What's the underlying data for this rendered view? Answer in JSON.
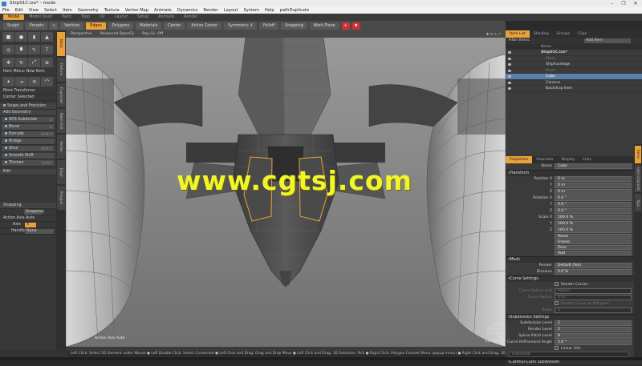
{
  "window": {
    "title": "Ship01C.lxo* - modo",
    "controls": [
      "–",
      "❐",
      "✕"
    ]
  },
  "menu": [
    "File",
    "Edit",
    "View",
    "Select",
    "Item",
    "Geometry",
    "Texture",
    "Vertex Map",
    "Animate",
    "Dynamics",
    "Render",
    "Layout",
    "System",
    "Help",
    "pathDuplicate"
  ],
  "layout_tabs": [
    {
      "label": "Model",
      "active": true
    },
    {
      "label": "Model Quad"
    },
    {
      "label": "Paint"
    },
    {
      "label": "Topo"
    },
    {
      "label": "UV"
    },
    {
      "label": "Layout"
    },
    {
      "label": "Setup"
    },
    {
      "label": "Animate"
    },
    {
      "label": "Render"
    }
  ],
  "toolbar": {
    "sculpt": "Sculpt",
    "presets": "Presets",
    "vertices": "Vertices",
    "edges": "Edges",
    "polygons": "Polygons",
    "materials": "Materials",
    "center": "Center",
    "action_center": "Action Center",
    "symmetry": "Symmetry: X",
    "falloff": "Falloff",
    "snapping": "Snapping",
    "work_plane": "Work Plane"
  },
  "left_panel": {
    "menu": "Item Menu: New Item",
    "more_transforms": "More Transforms",
    "center_selected": "Center Selected",
    "snaps": "Snaps and Precision",
    "add_geometry": "Add Geometry",
    "tools": [
      {
        "label": "SDS Subdivide",
        "shortcut": "D"
      },
      {
        "label": "Bevel",
        "shortcut": "B"
      },
      {
        "label": "Extrude",
        "shortcut": "Shift-X"
      },
      {
        "label": "Bridge",
        "shortcut": ""
      },
      {
        "label": "Slice",
        "shortcut": "Shift-C"
      },
      {
        "label": "Smooth Shift",
        "shortcut": ""
      },
      {
        "label": "Thicken",
        "shortcut": "Shift-T"
      }
    ],
    "edit": "Edit",
    "snapping_header": "Snapping",
    "snapping_value": "Snapping",
    "action_axis": "Action Axis Auto",
    "axis_label": "Axis",
    "axis_value": "X",
    "handle_label": "Handle",
    "handle_value": "None"
  },
  "left_tabs": [
    "Basic",
    "Deform",
    "Duplicate",
    "Mesh Edit",
    "Vertex",
    "Edge",
    "Polygon"
  ],
  "viewport": {
    "view_mode": "Perspective",
    "shading": "Advanced OpenGL",
    "ray_gl": "Ray GL: Off",
    "axis_text": "Action Axis Auto",
    "info": [
      "8 Edges",
      "Channels: 0",
      "Deformers: OFF",
      "GL: 365,068"
    ]
  },
  "watermark": "www.cgtsj.com",
  "status_bar": "Left Click: Select 3D Element under Mouse ● Left Double Click: Select Connected ● Left Click and Drag: Drag and Drop Move ● Left Click and Drag: 3D Selection: Pick ● Right Click: Polygon Context Menu (popup menu) ● Right Click and Drag: 3D Selection: Area ● Mi...",
  "item_list": {
    "tabs": [
      "Item List",
      "Shading",
      "Groups",
      "Clips"
    ],
    "add_item": "Add Item",
    "filter": "Filter Items",
    "name_col": "Name",
    "items": [
      {
        "label": "Ship01C.lxo*",
        "indent": 0
      },
      {
        "label": "Mesh",
        "indent": 1
      },
      {
        "label": "ShipFuselage",
        "indent": 1
      },
      {
        "label": "Mesh",
        "indent": 1
      },
      {
        "label": "Cube",
        "indent": 1,
        "selected": true
      },
      {
        "label": "Camera",
        "indent": 1
      },
      {
        "label": "Backdrop Item",
        "indent": 1
      }
    ]
  },
  "properties": {
    "tabs": [
      "Properties",
      "Channels",
      "Display",
      "Lists"
    ],
    "name_label": "Name",
    "name_value": "Cube",
    "transform_section": "Transform",
    "transform_rows": [
      {
        "label": "Position X",
        "value": "0 m"
      },
      {
        "label": "Y",
        "value": "0 m"
      },
      {
        "label": "Z",
        "value": "0 m"
      },
      {
        "label": "Rotation X",
        "value": "0.0 °"
      },
      {
        "label": "Y",
        "value": "0.0 °"
      },
      {
        "label": "Z",
        "value": "0.0 °"
      },
      {
        "label": "Scale X",
        "value": "100.0 %"
      },
      {
        "label": "Y",
        "value": "100.0 %"
      },
      {
        "label": "Z",
        "value": "100.0 %"
      }
    ],
    "transform_buttons": [
      "Reset",
      "Freeze",
      "Zero",
      "Add"
    ],
    "mesh_section": "Mesh",
    "render_label": "Render",
    "render_value": "Default (Yes)",
    "dissolve_label": "Dissolve",
    "dissolve_value": "0.0 %",
    "curve_section": "Curve Settings",
    "render_curves": "Render Curves",
    "curve_radius_unit": "Curve Radius Unit",
    "curve_radius_unit_value": "Meters",
    "curve_radius": "Curve Radius",
    "curve_radius_value": "0 m",
    "render_curve_poly": "Render Curve as Polygons",
    "sides": "Sides",
    "sides_value": "3",
    "subdiv_section": "Subdivision Settings",
    "subdiv_level": "Subdivision Level",
    "subdiv_level_value": "2",
    "render_level": "Render Level",
    "render_level_value": "2",
    "spline_patch": "Spline Patch Level",
    "spline_patch_value": "8",
    "curve_refine": "Curve Refinement Angle",
    "curve_refine_value": "5.0 °",
    "linear_uvs": "Linear UVs",
    "cage": "Cage",
    "catmull": "Catmull-Clark Subdivision",
    "command_placeholder": "Command"
  },
  "right_side_tabs": [
    "Items",
    "User Channels",
    "Tags"
  ],
  "colors": {
    "accent": "#e9a13a",
    "selection": "#5b7fa8",
    "watermark": "#f1f52a"
  }
}
